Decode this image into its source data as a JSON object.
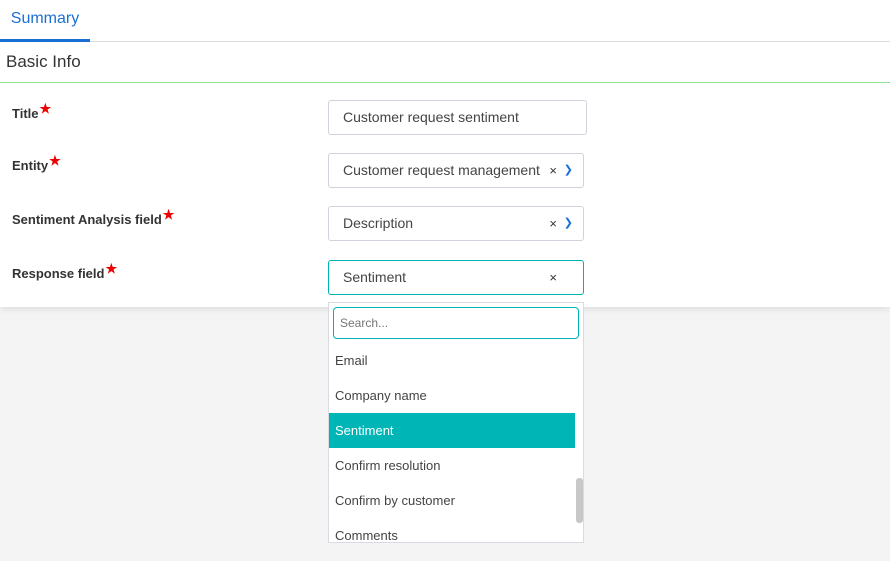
{
  "tabs": [
    {
      "label": "Summary",
      "active": true
    }
  ],
  "section": {
    "title": "Basic Info"
  },
  "fields": [
    {
      "label": "Title",
      "value": "Customer request sentiment",
      "required": true
    },
    {
      "label": "Entity",
      "value": "Customer request management",
      "required": true
    },
    {
      "label": "Sentiment Analysis field",
      "value": "Description",
      "required": true
    },
    {
      "label": "Response field",
      "value": "Sentiment",
      "required": true
    }
  ],
  "dropdown": {
    "search_placeholder": "Search...",
    "options": [
      "Email",
      "Company name",
      "Sentiment",
      "Confirm resolution",
      "Confirm by customer",
      "Comments"
    ],
    "selected": "Sentiment"
  },
  "colors": {
    "accent": "#00b5b5",
    "tab": "#1a6fd6",
    "required": "#ee0000"
  }
}
